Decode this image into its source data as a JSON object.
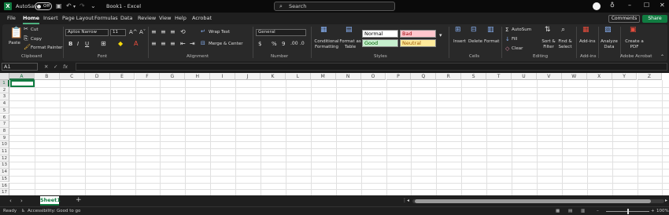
{
  "titlebar": {
    "autosave_label": "AutoSave",
    "autosave_state": "Off",
    "book_title": "Book1 - Excel",
    "search_placeholder": "Search"
  },
  "menu": {
    "items": [
      "File",
      "Home",
      "Insert",
      "Page Layout",
      "Formulas",
      "Data",
      "Review",
      "View",
      "Help",
      "Acrobat"
    ],
    "active": "Home",
    "comments": "Comments",
    "share": "Share"
  },
  "ribbon": {
    "clipboard": {
      "paste": "Paste",
      "cut": "Cut",
      "copy": "Copy",
      "format_painter": "Format Painter",
      "label": "Clipboard"
    },
    "font": {
      "name": "Aptos Narrow",
      "size": "11",
      "label": "Font"
    },
    "alignment": {
      "wrap": "Wrap Text",
      "merge": "Merge & Center",
      "label": "Alignment"
    },
    "number": {
      "format": "General",
      "label": "Number"
    },
    "styles": {
      "conditional": "Conditional Formatting",
      "format_table": "Format as Table",
      "normal": "Normal",
      "bad": "Bad",
      "good": "Good",
      "neutral": "Neutral",
      "label": "Styles"
    },
    "cells": {
      "insert": "Insert",
      "delete": "Delete",
      "format": "Format",
      "label": "Cells"
    },
    "editing": {
      "autosum": "AutoSum",
      "fill": "Fill",
      "clear": "Clear",
      "sort": "Sort & Filter",
      "find": "Find & Select",
      "label": "Editing"
    },
    "addins": {
      "addins": "Add-ins",
      "label": "Add-ins"
    },
    "analyze": {
      "label": "Analyze Data"
    },
    "acrobat": {
      "create": "Create a PDF",
      "label": "Adobe Acrobat"
    }
  },
  "formula_bar": {
    "name_box": "A1",
    "fx": "fx",
    "formula": ""
  },
  "sheet": {
    "columns": [
      "A",
      "B",
      "C",
      "D",
      "E",
      "F",
      "G",
      "H",
      "I",
      "J",
      "K",
      "L",
      "M",
      "N",
      "O",
      "P",
      "Q",
      "R",
      "S",
      "T",
      "U",
      "V",
      "W",
      "X",
      "Y",
      "Z"
    ],
    "rows": [
      "1",
      "2",
      "3",
      "4",
      "5",
      "6",
      "7",
      "8",
      "9",
      "10",
      "11",
      "12",
      "13",
      "14",
      "15",
      "16",
      "17"
    ],
    "active_cell": "A1"
  },
  "tabs": {
    "sheets": [
      "Sheet1"
    ],
    "active": "Sheet1",
    "add": "+"
  },
  "status": {
    "ready": "Ready",
    "accessibility": "Accessibility: Good to go",
    "zoom": "100%"
  }
}
